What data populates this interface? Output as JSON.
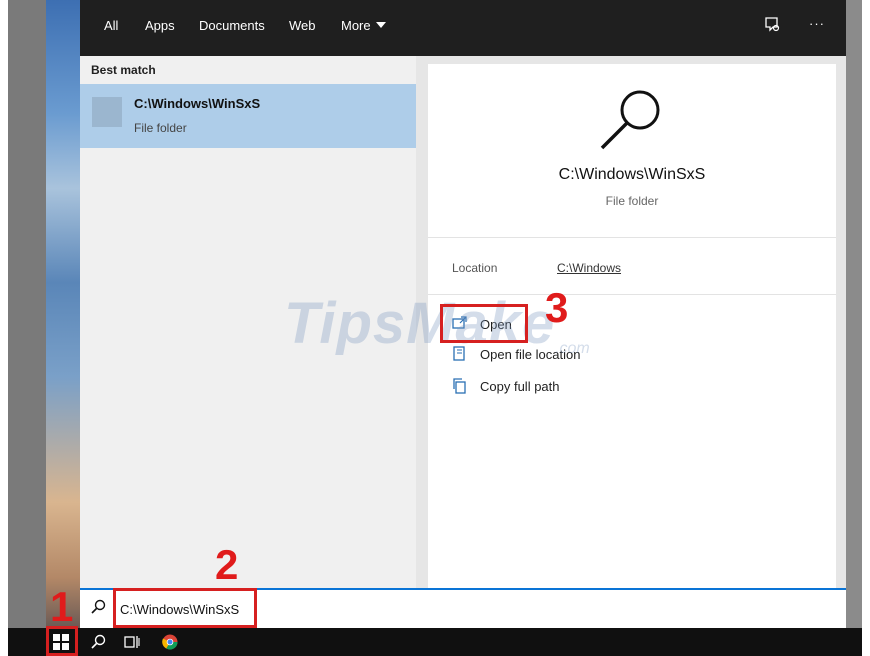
{
  "tabs": [
    "All",
    "Apps",
    "Documents",
    "Web",
    "More"
  ],
  "top_icons": [
    "feedback-icon",
    "more-options-icon"
  ],
  "top_right_more": "···",
  "best_match_label": "Best match",
  "result": {
    "title": "C:\\Windows\\WinSxS",
    "subtitle": "File folder"
  },
  "detail": {
    "title": "C:\\Windows\\WinSxS",
    "subtitle": "File folder",
    "location_label": "Location",
    "location_value": "C:\\Windows"
  },
  "actions": [
    {
      "label": "Open",
      "icon": "open-icon"
    },
    {
      "label": "Open file location",
      "icon": "file-location-icon"
    },
    {
      "label": "Copy full path",
      "icon": "copy-icon"
    }
  ],
  "search": {
    "value": "C:\\Windows\\WinSxS"
  },
  "steps": [
    "1",
    "2",
    "3"
  ],
  "watermark": {
    "main": "TipsMake",
    "suffix": ".com"
  },
  "colors": {
    "highlight": "#aecde9",
    "annotation": "#e01b1b",
    "search_border": "#0a74d6"
  }
}
